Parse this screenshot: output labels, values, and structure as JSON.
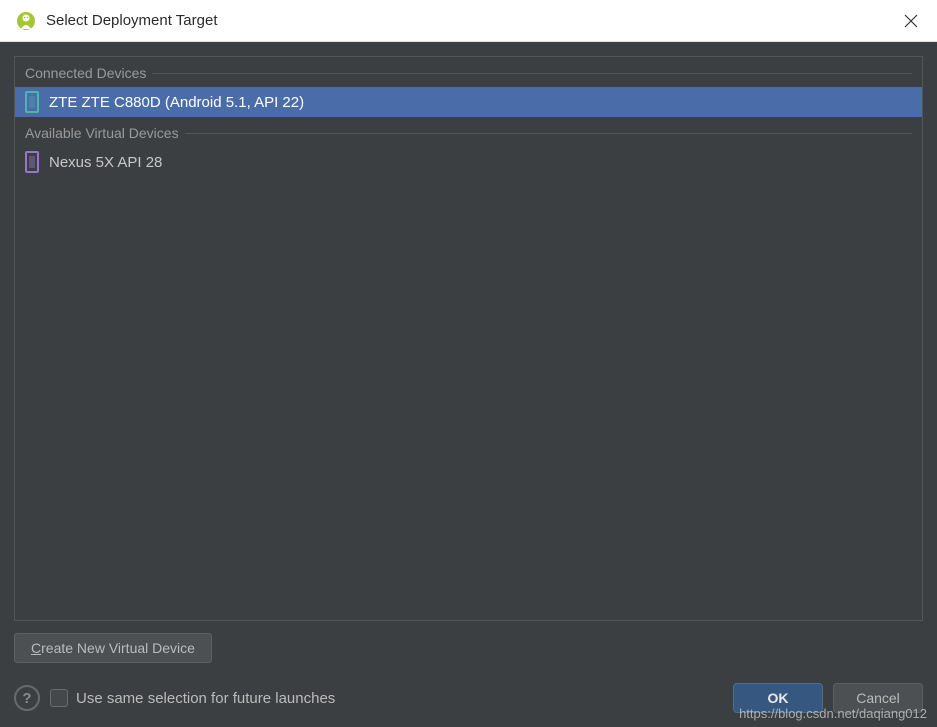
{
  "titlebar": {
    "title": "Select Deployment Target"
  },
  "sections": {
    "connected": {
      "header": "Connected Devices",
      "items": [
        {
          "label": "ZTE ZTE C880D (Android 5.1, API 22)"
        }
      ]
    },
    "virtual": {
      "header": "Available Virtual Devices",
      "items": [
        {
          "label": "Nexus 5X API 28"
        }
      ]
    }
  },
  "buttons": {
    "create_prefix": "C",
    "create_rest": "reate New Virtual Device",
    "ok": "OK",
    "cancel": "Cancel"
  },
  "checkbox": {
    "label": "Use same selection for future launches"
  },
  "help": {
    "label": "?"
  },
  "watermark": "https://blog.csdn.net/daqiang012"
}
